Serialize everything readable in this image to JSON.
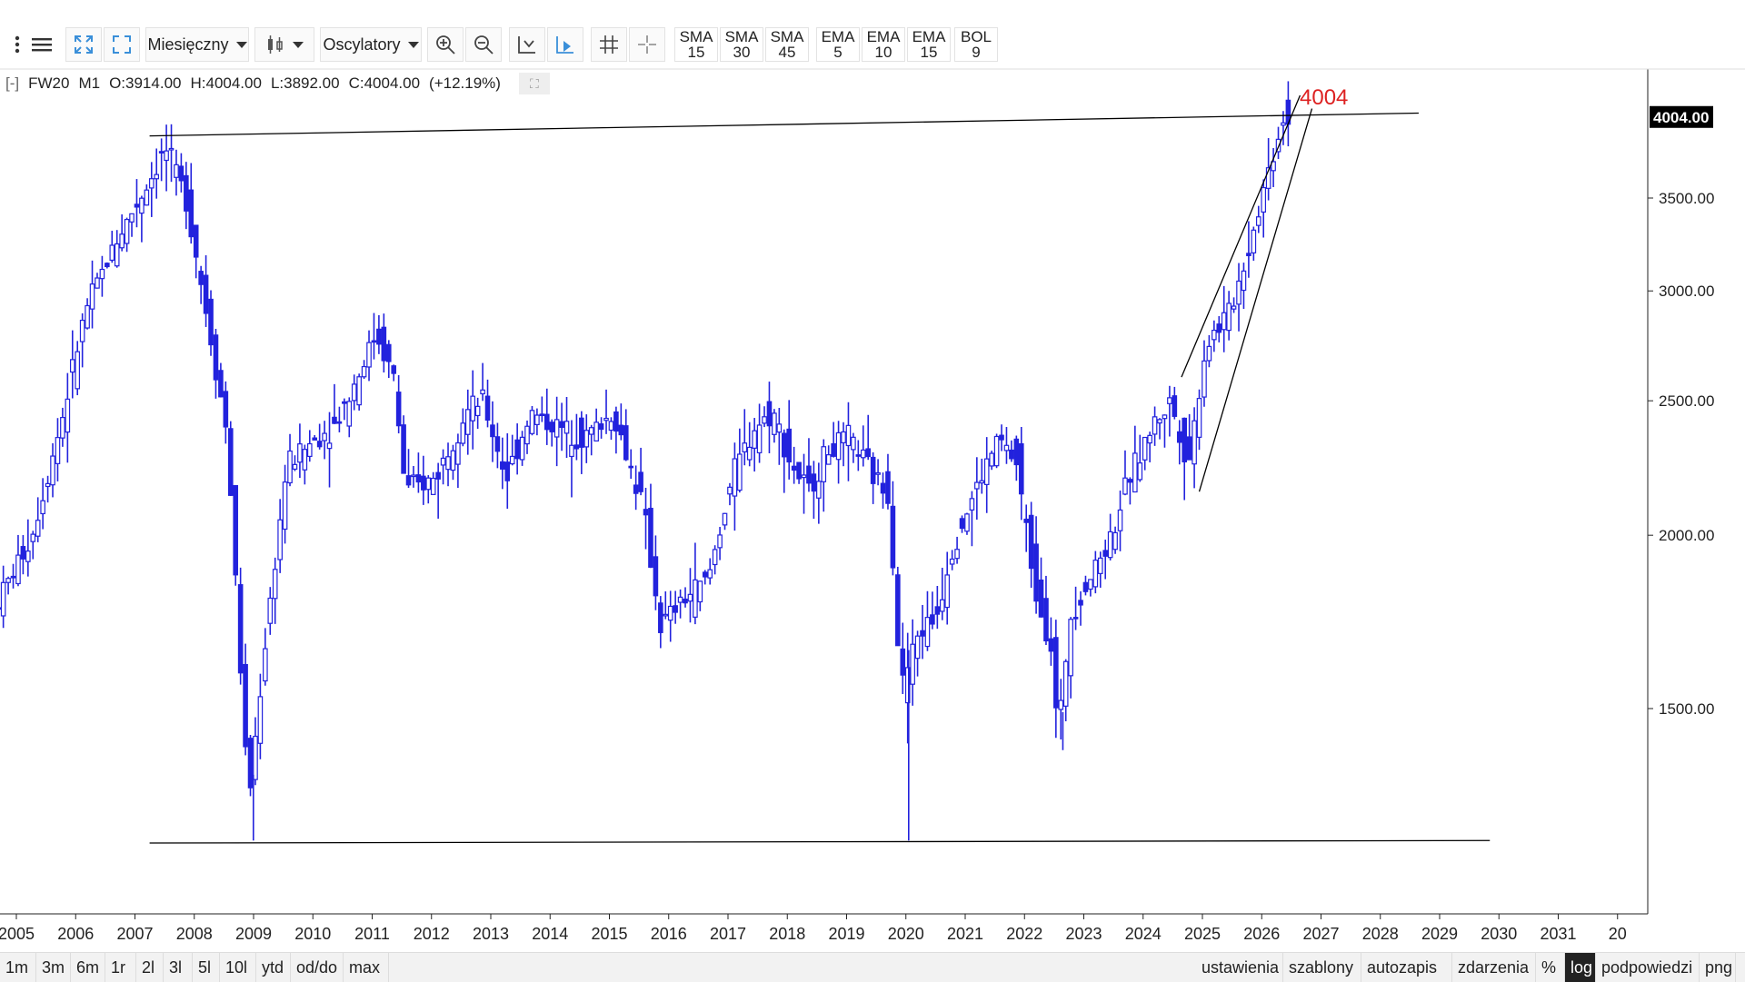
{
  "toolbar": {
    "interval_label": "Miesięczny",
    "oscillators_label": "Oscylatory",
    "indicators": [
      {
        "name": "SMA",
        "period": "15"
      },
      {
        "name": "SMA",
        "period": "30"
      },
      {
        "name": "SMA",
        "period": "45"
      },
      {
        "name": "EMA",
        "period": "5"
      },
      {
        "name": "EMA",
        "period": "10"
      },
      {
        "name": "EMA",
        "period": "15"
      },
      {
        "name": "BOL",
        "period": "9"
      }
    ]
  },
  "info": {
    "collapse": "[-]",
    "symbol": "FW20",
    "interval": "M1",
    "open": "O:3914.00",
    "high": "H:4004.00",
    "low": "L:3892.00",
    "close": "C:4004.00",
    "change": "(+12.19%)"
  },
  "bottom": {
    "ranges": [
      "1m",
      "3m",
      "6m",
      "1r",
      "2l",
      "3l",
      "5l",
      "10l",
      "ytd",
      "od/do",
      "max"
    ],
    "options": [
      "ustawienia",
      "szablony",
      "autozapis",
      "zdarzenia",
      "%",
      "log",
      "podpowiedzi",
      "png"
    ],
    "active_option": "log"
  },
  "chart_data": {
    "type": "candlestick",
    "symbol": "FW20",
    "y_scale": "log",
    "y_ticks": [
      "1500.00",
      "2000.00",
      "2500.00",
      "3000.00",
      "3500.00"
    ],
    "last_price_label": "4004.00",
    "annotation": "4004",
    "x_ticks": [
      "2005",
      "2006",
      "2007",
      "2008",
      "2009",
      "2010",
      "2011",
      "2012",
      "2013",
      "2014",
      "2015",
      "2016",
      "2017",
      "2018",
      "2019",
      "2020",
      "2021",
      "2022",
      "2023",
      "2024",
      "2025",
      "2026",
      "2027",
      "2028",
      "2029",
      "2030",
      "2031",
      "20"
    ],
    "ylim": [
      1100,
      4300
    ],
    "colors": {
      "candle": "#2222dd",
      "line": "#000000",
      "annotation": "#dd2222"
    },
    "price_anchors": [
      {
        "t": 2004.8,
        "v": 1750
      },
      {
        "t": 2005.5,
        "v": 2000
      },
      {
        "t": 2006.0,
        "v": 2420
      },
      {
        "t": 2006.4,
        "v": 2900
      },
      {
        "t": 2006.9,
        "v": 3250
      },
      {
        "t": 2007.4,
        "v": 3550
      },
      {
        "t": 2007.75,
        "v": 3800
      },
      {
        "t": 2008.1,
        "v": 3500
      },
      {
        "t": 2008.5,
        "v": 2800
      },
      {
        "t": 2008.8,
        "v": 2350
      },
      {
        "t": 2009.0,
        "v": 1650
      },
      {
        "t": 2009.15,
        "v": 1280
      },
      {
        "t": 2009.45,
        "v": 1700
      },
      {
        "t": 2009.8,
        "v": 2250
      },
      {
        "t": 2010.3,
        "v": 2350
      },
      {
        "t": 2010.6,
        "v": 2400
      },
      {
        "t": 2010.9,
        "v": 2550
      },
      {
        "t": 2011.3,
        "v": 2800
      },
      {
        "t": 2011.6,
        "v": 2600
      },
      {
        "t": 2011.8,
        "v": 2150
      },
      {
        "t": 2012.3,
        "v": 2200
      },
      {
        "t": 2012.8,
        "v": 2450
      },
      {
        "t": 2013.1,
        "v": 2500
      },
      {
        "t": 2013.5,
        "v": 2200
      },
      {
        "t": 2013.9,
        "v": 2450
      },
      {
        "t": 2014.3,
        "v": 2400
      },
      {
        "t": 2014.8,
        "v": 2350
      },
      {
        "t": 2015.3,
        "v": 2450
      },
      {
        "t": 2015.8,
        "v": 2100
      },
      {
        "t": 2016.1,
        "v": 1720
      },
      {
        "t": 2016.5,
        "v": 1800
      },
      {
        "t": 2016.9,
        "v": 1860
      },
      {
        "t": 2017.3,
        "v": 2200
      },
      {
        "t": 2017.7,
        "v": 2400
      },
      {
        "t": 2018.0,
        "v": 2450
      },
      {
        "t": 2018.3,
        "v": 2250
      },
      {
        "t": 2018.6,
        "v": 2150
      },
      {
        "t": 2018.9,
        "v": 2300
      },
      {
        "t": 2019.3,
        "v": 2350
      },
      {
        "t": 2019.7,
        "v": 2200
      },
      {
        "t": 2019.95,
        "v": 2150
      },
      {
        "t": 2020.15,
        "v": 1550
      },
      {
        "t": 2020.45,
        "v": 1700
      },
      {
        "t": 2020.75,
        "v": 1750
      },
      {
        "t": 2021.0,
        "v": 1950
      },
      {
        "t": 2021.4,
        "v": 2150
      },
      {
        "t": 2021.8,
        "v": 2350
      },
      {
        "t": 2022.1,
        "v": 2250
      },
      {
        "t": 2022.4,
        "v": 1850
      },
      {
        "t": 2022.7,
        "v": 1650
      },
      {
        "t": 2022.8,
        "v": 1420
      },
      {
        "t": 2023.0,
        "v": 1750
      },
      {
        "t": 2023.3,
        "v": 1850
      },
      {
        "t": 2023.7,
        "v": 2000
      },
      {
        "t": 2024.0,
        "v": 2200
      },
      {
        "t": 2024.4,
        "v": 2400
      },
      {
        "t": 2024.7,
        "v": 2500
      },
      {
        "t": 2025.0,
        "v": 2250
      },
      {
        "t": 2025.3,
        "v": 2750
      },
      {
        "t": 2025.7,
        "v": 2900
      },
      {
        "t": 2026.0,
        "v": 3200
      },
      {
        "t": 2026.3,
        "v": 3600
      },
      {
        "t": 2026.6,
        "v": 4004
      }
    ],
    "trendlines": [
      {
        "label": "resistance",
        "from": {
          "t": 2007.4,
          "v": 3880
        },
        "to": {
          "t": 2028.8,
          "v": 4030
        }
      },
      {
        "label": "support",
        "from": {
          "t": 2007.4,
          "v": 1200
        },
        "to": {
          "t": 2030.0,
          "v": 1205
        }
      },
      {
        "label": "channel-upper",
        "from": {
          "t": 2024.8,
          "v": 2600
        },
        "to": {
          "t": 2026.8,
          "v": 4150
        }
      },
      {
        "label": "channel-lower",
        "from": {
          "t": 2025.1,
          "v": 2150
        },
        "to": {
          "t": 2027.0,
          "v": 4060
        }
      }
    ]
  }
}
